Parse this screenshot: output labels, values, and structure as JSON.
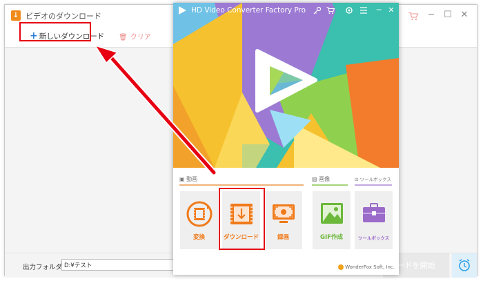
{
  "downloader": {
    "title": "ビデオのダウンロード",
    "new_download_label": "新しいダウンロード",
    "clear_label": "クリア",
    "output_folder_label": "出力フォルダ：",
    "output_folder_value": "D:¥テスト",
    "start_label": "ードを開始"
  },
  "converter": {
    "title": "HD Video Converter Factory Pro",
    "sections": {
      "video": "動画",
      "image": "画像",
      "toolbox": "ツールボックス"
    },
    "tools": [
      {
        "label": "変換",
        "color": "#f07a1a",
        "icon": "convert-film-icon"
      },
      {
        "label": "ダウンロード",
        "color": "#f07a1a",
        "icon": "download-icon"
      },
      {
        "label": "録画",
        "color": "#f07a1a",
        "icon": "screen-record-icon"
      },
      {
        "label": "GIF作成",
        "color": "#6bb83a",
        "icon": "gif-image-icon"
      },
      {
        "label": "ツールボックス",
        "color": "#9b6bc9",
        "icon": "toolbox-icon"
      }
    ],
    "brand": "WonderFox Soft, Inc."
  },
  "colors": {
    "highlight": "#e60012",
    "orange": "#f07a1a",
    "green": "#6bb83a",
    "purple": "#9b6bc9",
    "teal": "#33c0b0"
  }
}
